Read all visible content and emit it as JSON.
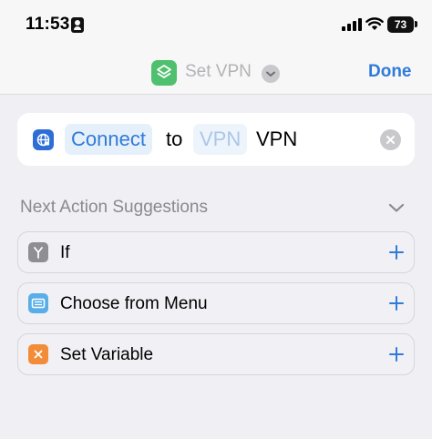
{
  "status_bar": {
    "time": "11:53",
    "battery": "73",
    "icons": [
      "contact-card-icon",
      "cellular-signal-icon",
      "wifi-icon",
      "battery-icon"
    ]
  },
  "nav": {
    "title": "Set VPN",
    "done_label": "Done",
    "icon": "shortcuts-layers-icon",
    "chevron": "chevron-down-icon"
  },
  "action": {
    "icon": "vpn-globe-icon",
    "verb": "Connect",
    "to": "to",
    "placeholder": "VPN",
    "noun": "VPN",
    "clear_icon": "clear-x-icon"
  },
  "suggestions": {
    "header": "Next Action Suggestions",
    "collapse_icon": "chevron-down-icon",
    "items": [
      {
        "label": "If",
        "icon": "branch-icon",
        "color": "#8e8e93"
      },
      {
        "label": "Choose from Menu",
        "icon": "menu-icon",
        "color": "#5aaee8"
      },
      {
        "label": "Set Variable",
        "icon": "variable-x-icon",
        "color": "#f28c38"
      }
    ]
  },
  "colors": {
    "accent": "#2f7bd9",
    "background": "#efeff4",
    "shortcut_green": "#4fc06e"
  }
}
